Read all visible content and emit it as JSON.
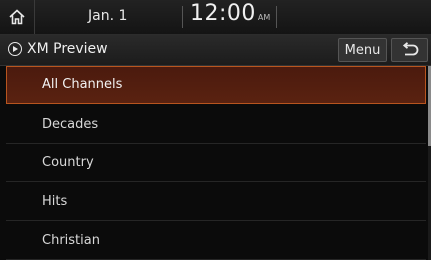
{
  "status": {
    "date": "Jan. 1",
    "time": "12:00",
    "ampm": "AM",
    "home_icon": "home-icon"
  },
  "header": {
    "title": "XM Preview",
    "play_icon": "play-circle-icon",
    "menu_label": "Menu",
    "back_icon": "back-arrow-icon"
  },
  "list": {
    "items": [
      {
        "label": "All Channels",
        "selected": true
      },
      {
        "label": "Decades",
        "selected": false
      },
      {
        "label": "Country",
        "selected": false
      },
      {
        "label": "Hits",
        "selected": false
      },
      {
        "label": "Christian",
        "selected": false
      }
    ]
  },
  "colors": {
    "selected_bg": "#5a2210",
    "selected_border": "#b8551f",
    "background": "#0b0b0b"
  }
}
